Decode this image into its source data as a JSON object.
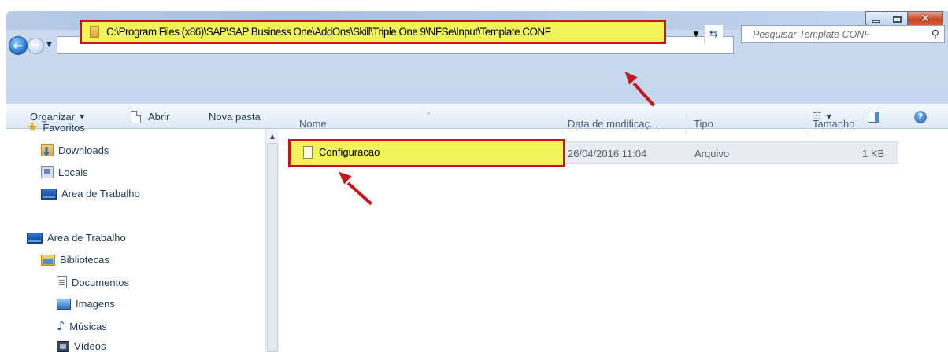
{
  "window": {
    "controls": {
      "min": "minimize-icon",
      "max": "maximize-icon",
      "close": "close-icon"
    }
  },
  "address": {
    "path": "C:\\Program Files (x86)\\SAP\\SAP Business One\\AddOns\\Skill\\Triple One 9\\NFSe\\Input\\Template CONF"
  },
  "search": {
    "placeholder": "Pesquisar Template CONF"
  },
  "toolbar": {
    "organize_label": "Organizar",
    "open_label": "Abrir",
    "new_folder_label": "Nova pasta"
  },
  "nav": {
    "favorites_label": "Favoritos",
    "downloads_label": "Downloads",
    "locais_label": "Locais",
    "desktop_fav_label": "Área de Trabalho",
    "desktop_label": "Área de Trabalho",
    "libraries_label": "Bibliotecas",
    "documents_label": "Documentos",
    "images_label": "Imagens",
    "music_label": "Músicas",
    "videos_label": "Vídeos"
  },
  "columns": {
    "name": "Nome",
    "date": "Data de modificaç...",
    "type": "Tipo",
    "size": "Tamanho"
  },
  "files": [
    {
      "name": "Configuracao",
      "date": "26/04/2016 11:04",
      "type": "Arquivo",
      "size": "1 KB"
    }
  ],
  "colors": {
    "highlight": "#f2f25a",
    "annotation_red": "#c4161c"
  }
}
